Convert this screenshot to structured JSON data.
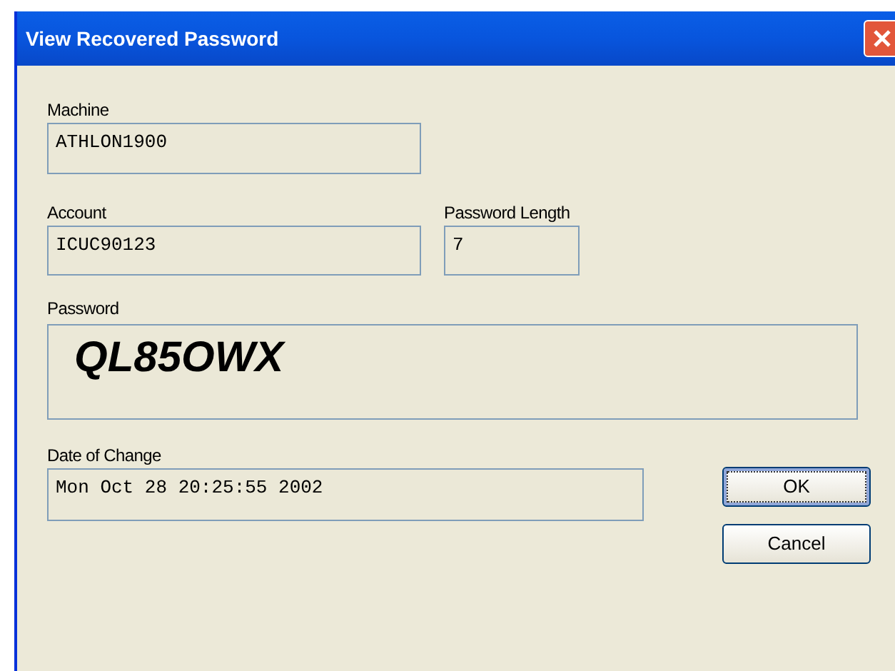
{
  "window": {
    "title": "View Recovered Password"
  },
  "machine": {
    "label": "Machine",
    "value": "ATHLON1900"
  },
  "account": {
    "label": "Account",
    "value": "ICUC90123"
  },
  "password_length": {
    "label": "Password Length",
    "value": "7"
  },
  "password": {
    "label": "Password",
    "value": "QL85OWX"
  },
  "date_of_change": {
    "label": "Date of Change",
    "value": "Mon Oct 28 20:25:55 2002"
  },
  "buttons": [
    {
      "label": "OK",
      "focused": true
    },
    {
      "label": "Cancel",
      "focused": false
    }
  ]
}
